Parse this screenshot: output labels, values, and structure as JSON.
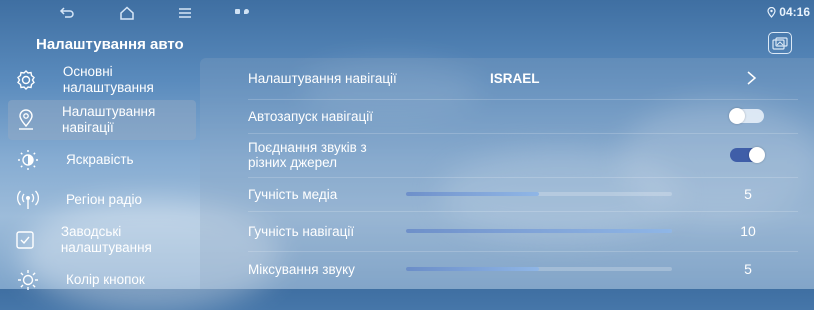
{
  "status_bar": {
    "nav_icons": [
      "back-icon",
      "home-icon",
      "menu-icon"
    ],
    "indicator_icons": [
      "notification-icon",
      "location-icon"
    ],
    "clock_icon": "location-pin-icon",
    "time": "04:16"
  },
  "header": {
    "title": "Налаштування авто",
    "gallery_icon": "gallery-icon"
  },
  "sidebar": {
    "items": [
      {
        "icon": "gear-icon",
        "label": "Основні налаштування",
        "active": false
      },
      {
        "icon": "map-pin-icon",
        "label": "Налаштування навігації",
        "active": true
      },
      {
        "icon": "brightness-icon",
        "label": "Яскравість",
        "active": false
      },
      {
        "icon": "radio-icon",
        "label": "Регіон радіо",
        "active": false
      },
      {
        "icon": "checkbox-icon",
        "label": "Заводські налаштування",
        "active": false
      },
      {
        "icon": "sun-icon",
        "label": "Колір кнопок",
        "active": false
      }
    ]
  },
  "settings": {
    "navigation": {
      "label": "Налаштування навігації",
      "value": "ISRAEL"
    },
    "autostart": {
      "label": "Автозапуск навігації",
      "enabled": false
    },
    "mix_sources": {
      "label": "Поєднання звуків з різних джерел",
      "enabled": true
    },
    "media_volume": {
      "label": "Гучність медіа",
      "value": "5",
      "level": 0.5
    },
    "nav_volume": {
      "label": "Гучність навігації",
      "value": "10",
      "level": 1.0
    },
    "sound_mixing": {
      "label": "Міксування звуку",
      "value": "5",
      "level": 0.5
    }
  },
  "colors": {
    "accent": "#3f5ea8",
    "toggle_off": "#e6eef8",
    "text": "#ffffff"
  }
}
